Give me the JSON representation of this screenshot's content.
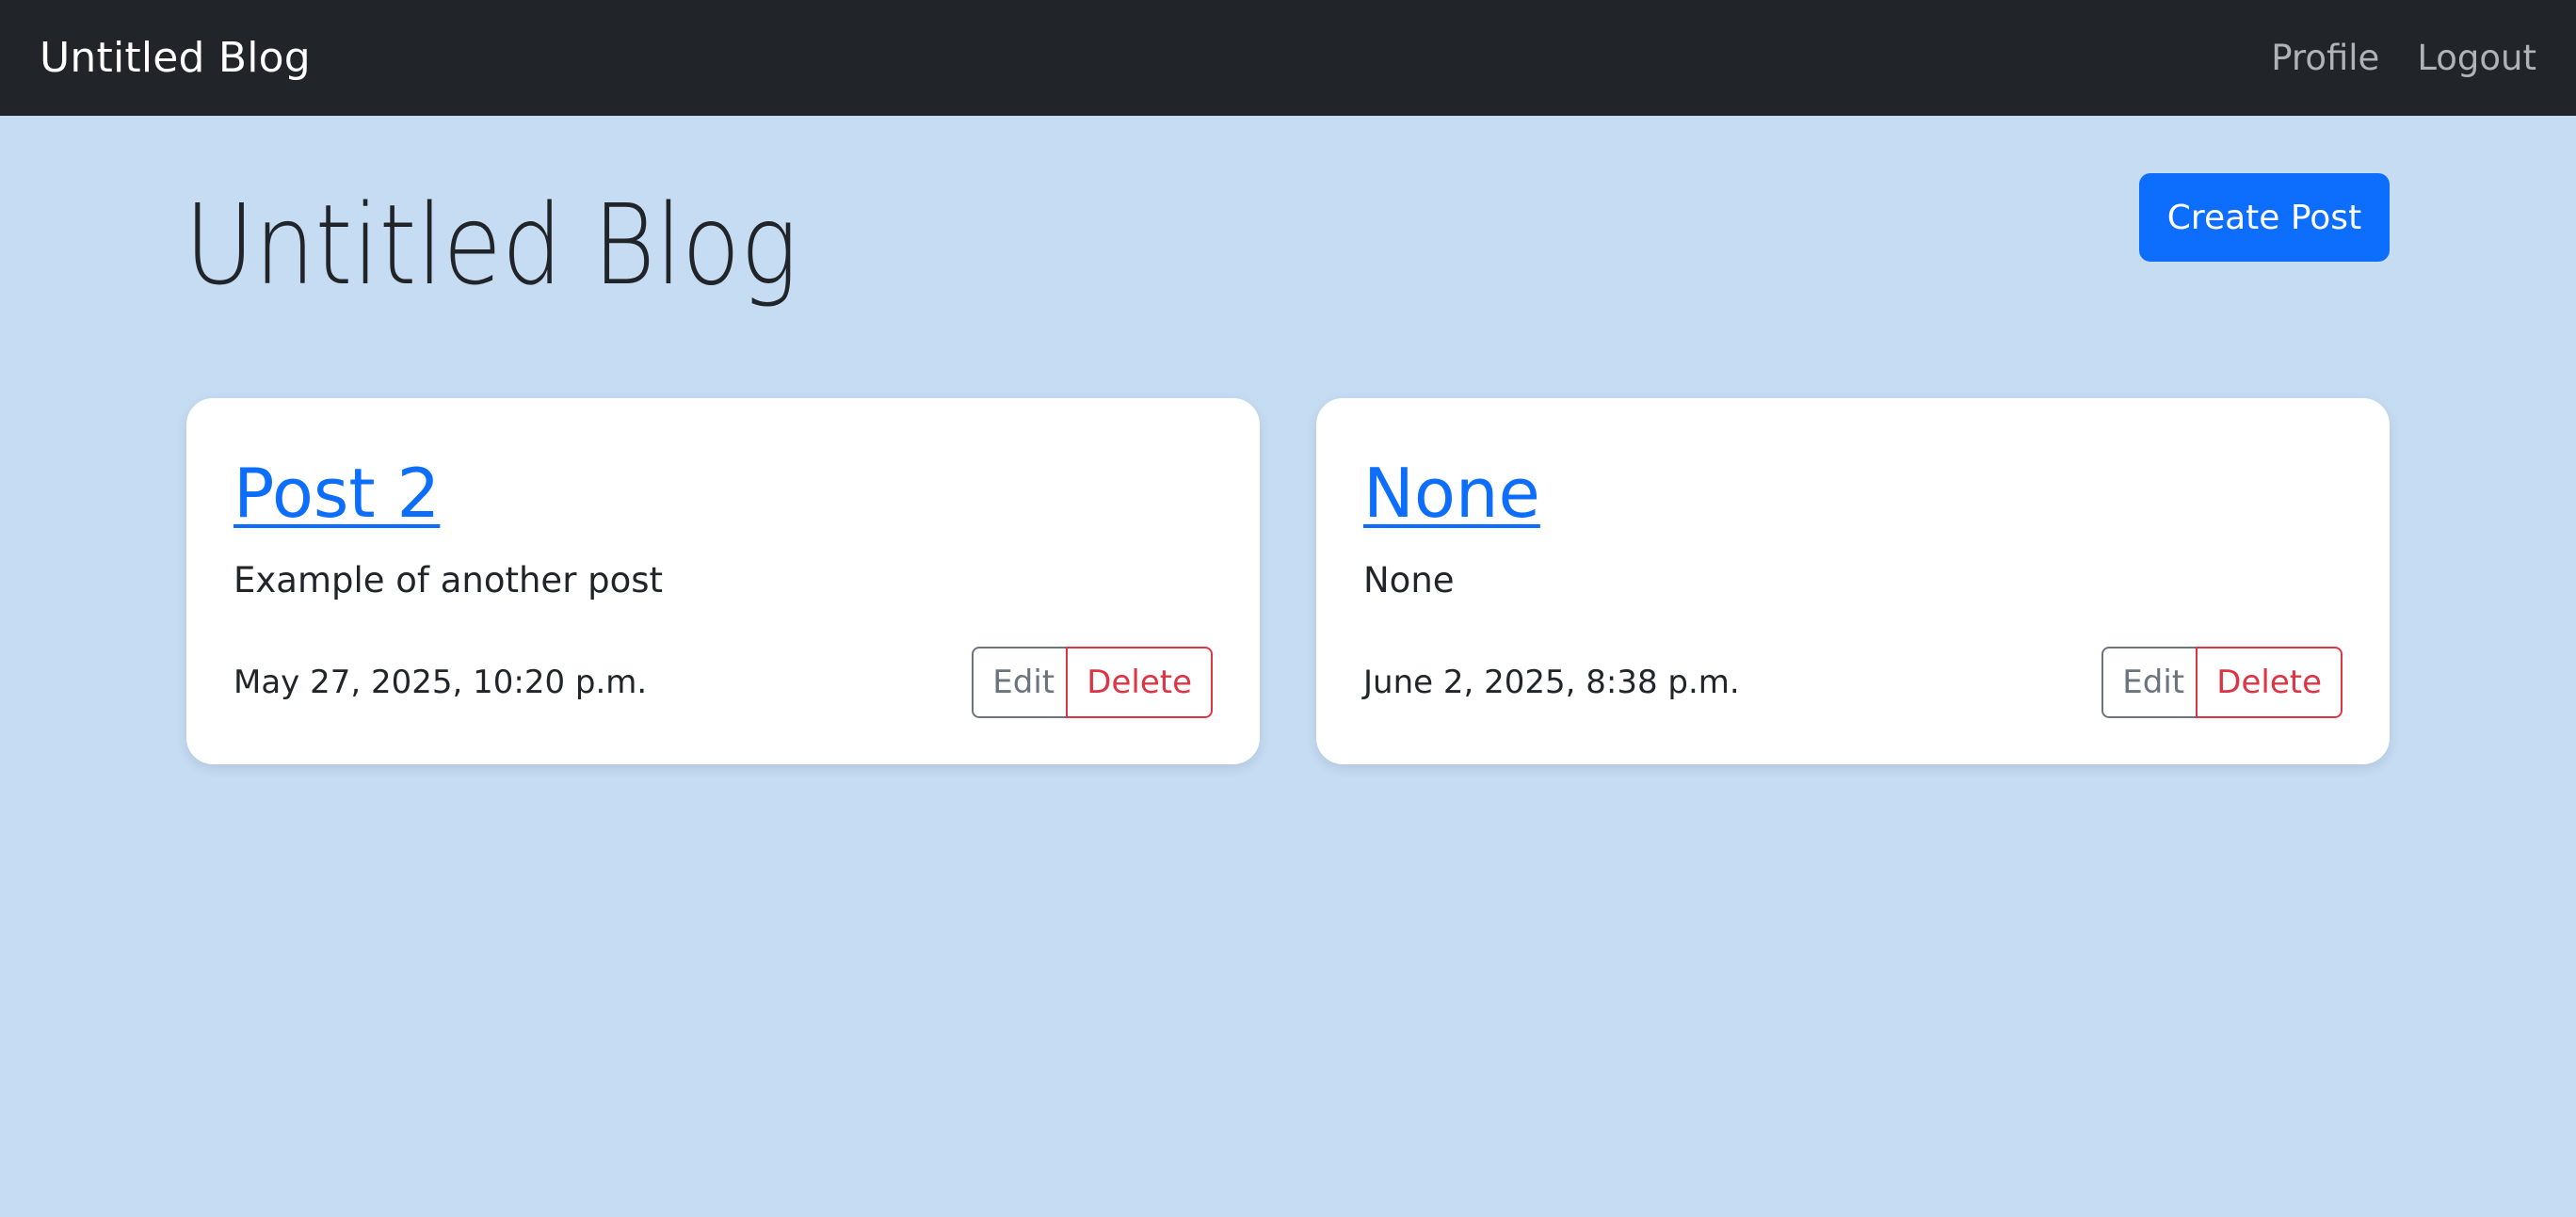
{
  "navbar": {
    "brand": "Untitled Blog",
    "links": [
      "Profile",
      "Logout"
    ]
  },
  "page": {
    "title": "Untitled Blog",
    "create_button": "Create Post"
  },
  "posts": [
    {
      "title": "Post 2",
      "body": "Example of another post",
      "date": "May 27, 2025, 10:20 p.m.",
      "edit_label": "Edit",
      "delete_label": "Delete"
    },
    {
      "title": "None",
      "body": "None",
      "date": "June 2, 2025, 8:38 p.m.",
      "edit_label": "Edit",
      "delete_label": "Delete"
    }
  ],
  "colors": {
    "navbar_bg": "#212529",
    "page_bg": "#c6dcf3",
    "primary": "#0d6efd",
    "secondary": "#6c757d",
    "danger": "#dc3545"
  }
}
